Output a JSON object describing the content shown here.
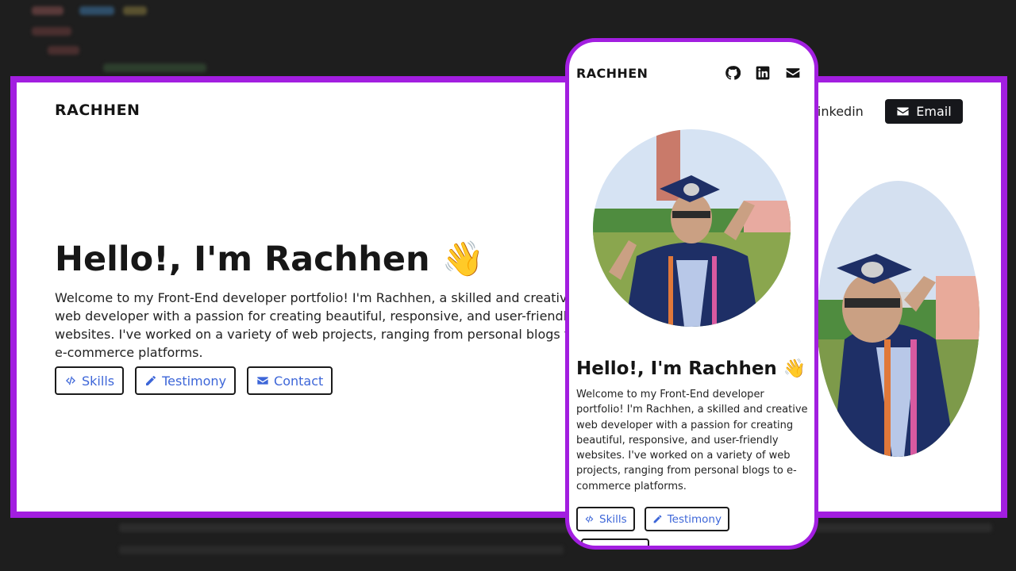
{
  "colors": {
    "frame": "#a21ee0",
    "link": "#3d66d8",
    "dark_button": "#16171b"
  },
  "desktop": {
    "logo": "RACHHEN",
    "nav": {
      "linkedin_label": "Linkedin",
      "email_label": "Email"
    },
    "hero": {
      "title": "Hello!, I'm Rachhen 👋",
      "description": "Welcome to my Front-End developer portfolio! I'm Rachhen, a skilled and creative web developer with a passion for creating beautiful, responsive, and user-friendly websites. I've worked on a variety of web projects, ranging from personal blogs to e-commerce platforms."
    },
    "buttons": {
      "skills": "Skills",
      "testimony": "Testimony",
      "contact": "Contact"
    }
  },
  "mobile": {
    "logo": "RACHHEN",
    "icons": [
      "github-icon",
      "linkedin-icon",
      "email-icon"
    ],
    "hero": {
      "title": "Hello!, I'm Rachhen 👋",
      "description": "Welcome to my Front-End developer portfolio! I'm Rachhen, a skilled and creative web developer with a passion for creating beautiful, responsive, and user-friendly websites. I've worked on a variety of web projects, ranging from personal blogs to e-commerce platforms."
    },
    "buttons": {
      "skills": "Skills",
      "testimony": "Testimony"
    }
  }
}
